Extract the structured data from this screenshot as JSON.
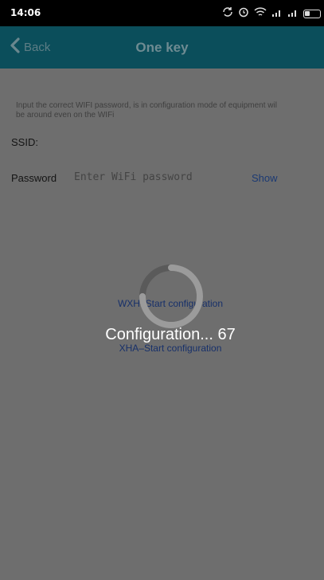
{
  "status_bar": {
    "time": "14:06",
    "icons": [
      "sync-icon",
      "alarm-icon",
      "wifi-icon",
      "signal-icon",
      "signal-icon",
      "battery-icon"
    ]
  },
  "app_bar": {
    "back_label": "Back",
    "title": "One key",
    "color": "#0b4e5b"
  },
  "form": {
    "hint_line1": "Input the correct WIFI password, is in configuration mode of equipment wil",
    "hint_line2": "be around even on the WIFi",
    "ssid_label": "SSID:",
    "password_label": "Password",
    "password_placeholder": "Enter WiFi password",
    "show_label": "Show"
  },
  "actions": {
    "wxh_label": "WXH–Start configuration",
    "xha_label": "XHA–Start configuration"
  },
  "progress_overlay": {
    "text": "Configuration... 67",
    "progress": 67
  }
}
